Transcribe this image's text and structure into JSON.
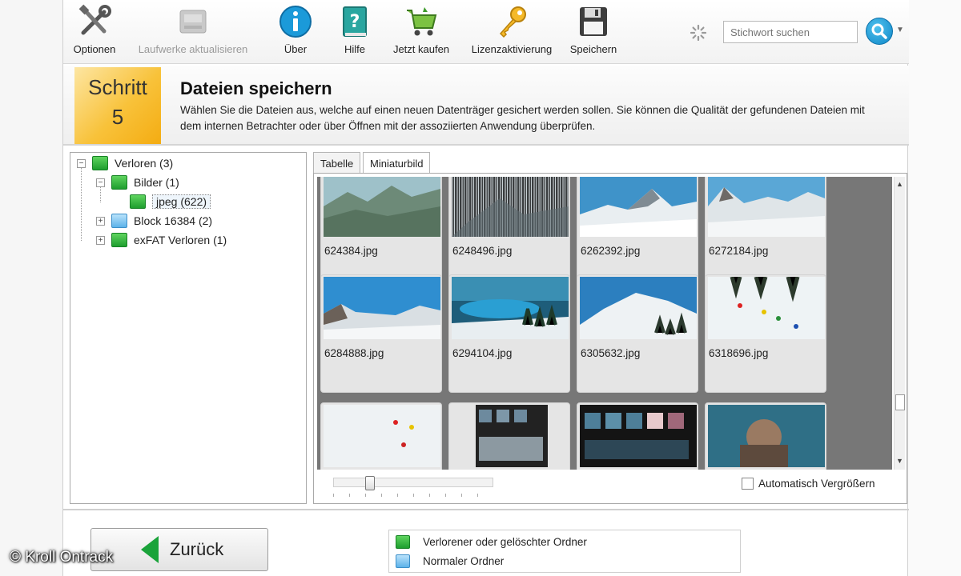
{
  "toolbar": {
    "items": [
      {
        "label": "Optionen",
        "icon": "tools-icon",
        "enabled": true
      },
      {
        "label": "Laufwerke aktualisieren",
        "icon": "drive-refresh-icon",
        "enabled": false
      },
      {
        "label": "Über",
        "icon": "info-icon",
        "enabled": true
      },
      {
        "label": "Hilfe",
        "icon": "help-book-icon",
        "enabled": true
      },
      {
        "label": "Jetzt kaufen",
        "icon": "shopping-cart-icon",
        "enabled": true
      },
      {
        "label": "Lizenzaktivierung",
        "icon": "key-icon",
        "enabled": true
      },
      {
        "label": "Speichern",
        "icon": "floppy-disk-icon",
        "enabled": true
      }
    ],
    "search": {
      "placeholder": "Stichwort suchen"
    }
  },
  "step": {
    "word": "Schritt",
    "number": "5",
    "title": "Dateien speichern",
    "description": "Wählen Sie die Dateien aus, welche auf einen neuen Datenträger gesichert werden sollen. Sie können die Qualität der gefundenen Dateien mit dem internen Betrachter oder über Öffnen mit der assoziierten Anwendung überprüfen."
  },
  "tree": {
    "root": "Verloren (3)",
    "bilder": "Bilder (1)",
    "jpeg": "jpeg (622)",
    "block": "Block 16384 (2)",
    "exfat": "exFAT Verloren (1)"
  },
  "tabs": {
    "table": "Tabelle",
    "thumbnail": "Miniaturbild"
  },
  "thumbnails": [
    {
      "name": "624384.jpg"
    },
    {
      "name": "6248496.jpg"
    },
    {
      "name": "6262392.jpg"
    },
    {
      "name": "6272184.jpg"
    },
    {
      "name": "6284888.jpg"
    },
    {
      "name": "6294104.jpg"
    },
    {
      "name": "6305632.jpg"
    },
    {
      "name": "6318696.jpg"
    },
    {
      "name": ""
    },
    {
      "name": ""
    },
    {
      "name": ""
    },
    {
      "name": ""
    }
  ],
  "autozoom": {
    "label": "Automatisch Vergrößern",
    "checked": false
  },
  "back_button": {
    "label": "Zurück"
  },
  "legend": {
    "lost": "Verlorener oder gelöschter Ordner",
    "normal": "Normaler Ordner"
  },
  "watermark": "© Kroll Ontrack",
  "colors": {
    "accent": "#0f87c7",
    "step": "#f8c23a",
    "folder_lost": "#1e9e2e",
    "folder_normal": "#5db2e9"
  }
}
